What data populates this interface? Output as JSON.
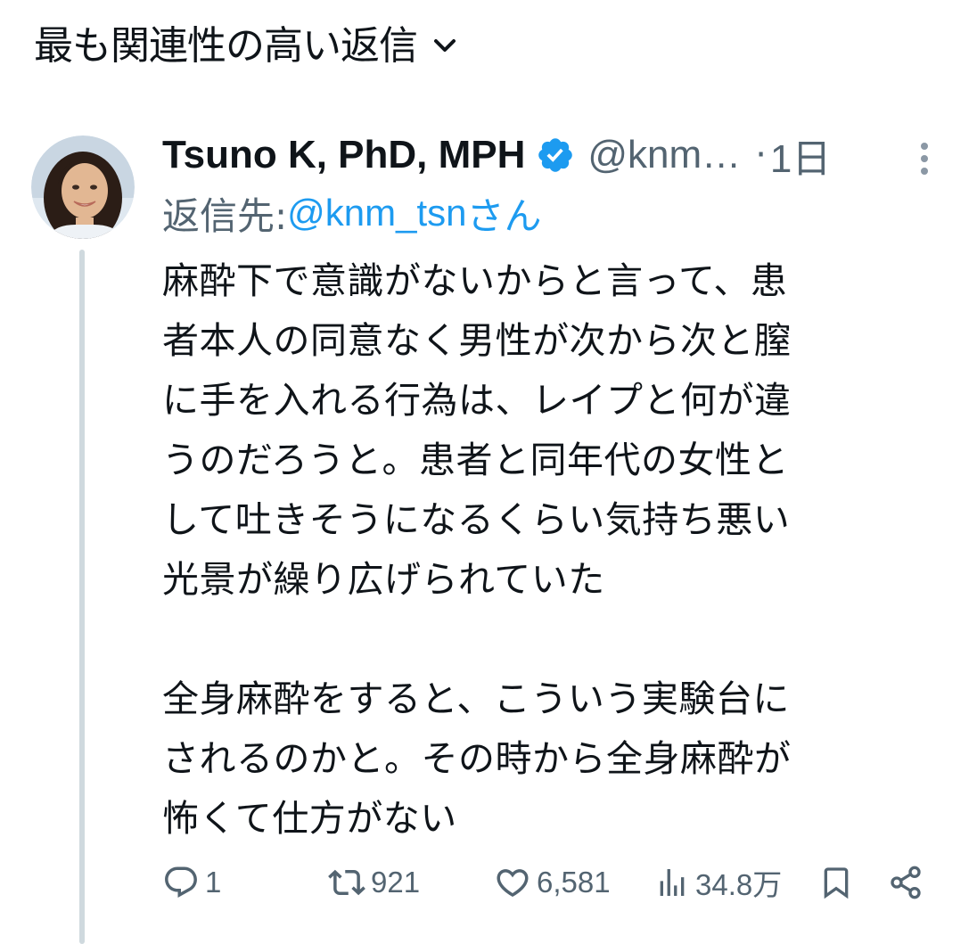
{
  "sort": {
    "label": "最も関連性の高い返信"
  },
  "tweet": {
    "author": {
      "display_name": "Tsuno K, PhD, MPH",
      "handle": "@knm…",
      "verified": true
    },
    "separator": "·",
    "timestamp": "1日",
    "reply_to": {
      "prefix": "返信先: ",
      "user": "@knm_tsn",
      "suffix": "さん"
    },
    "text_lines_p1": [
      "麻酔下で意識がないからと言って、患",
      "者本人の同意なく男性が次から次と膣",
      "に手を入れる行為は、レイプと何が違",
      "うのだろうと。患者と同年代の女性と",
      "して吐きそうになるくらい気持ち悪い",
      "光景が繰り広げられていた"
    ],
    "text_lines_p2": [
      "全身麻酔をすると、こういう実験台に",
      "されるのかと。その時から全身麻酔が",
      "怖くて仕方がない"
    ],
    "metrics": {
      "replies": "1",
      "retweets": "921",
      "likes": "6,581",
      "views": "34.8万"
    }
  },
  "colors": {
    "text": "#0f1419",
    "secondary": "#536471",
    "accent": "#1d9bf0",
    "thread_line": "#cfd9de"
  },
  "icons": {
    "sort": "chevron-down-icon",
    "verified": "verified-badge-icon",
    "more": "more-vertical-icon",
    "reply": "reply-icon",
    "retweet": "retweet-icon",
    "like": "heart-icon",
    "views": "views-icon",
    "bookmark": "bookmark-icon",
    "share": "share-icon"
  }
}
